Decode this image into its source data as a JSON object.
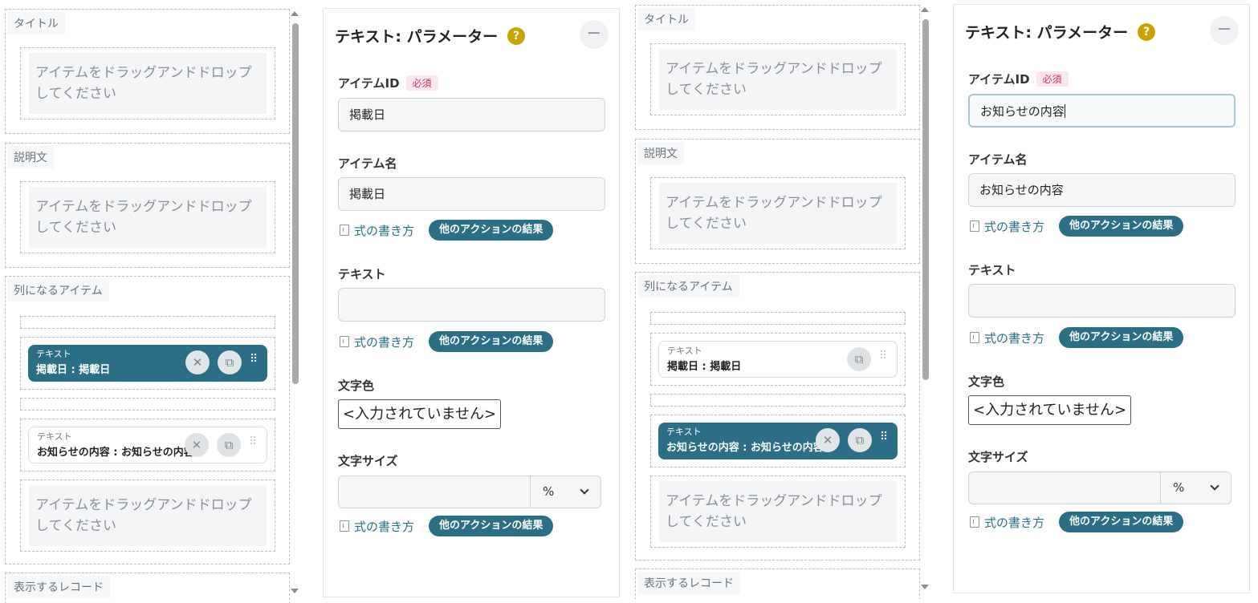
{
  "layout_areas": {
    "title": "タイトル",
    "description": "説明文",
    "list_items": "列になるアイテム",
    "records": "表示するレコード"
  },
  "drop_placeholder": "アイテムをドラッグアンドドロップしてください",
  "item_card": {
    "type_label": "テキスト",
    "item1_text": "掲載日 : 掲載日",
    "item2_text": "お知らせの内容 : お知らせの内容"
  },
  "panel": {
    "title": "テキスト: パラメーター",
    "help_symbol": "?",
    "collapse_symbol": "−",
    "item_id_label": "アイテムID",
    "required_badge": "必須",
    "item_name_label": "アイテム名",
    "text_label": "テキスト",
    "text_color_label": "文字色",
    "text_color_value": "<入力されていません>",
    "text_size_label": "文字サイズ",
    "text_size_unit": "%",
    "formula_link": "式の書き方",
    "other_actions_button": "他のアクションの結果"
  },
  "state1": {
    "item_id_value": "掲載日",
    "item_name_value": "掲載日"
  },
  "state2": {
    "item_id_value": "お知らせの内容",
    "item_name_value": "お知らせの内容"
  },
  "colors": {
    "accent": "#2a6f86",
    "required_text": "#d0306a",
    "help_badge": "#c9a400"
  }
}
